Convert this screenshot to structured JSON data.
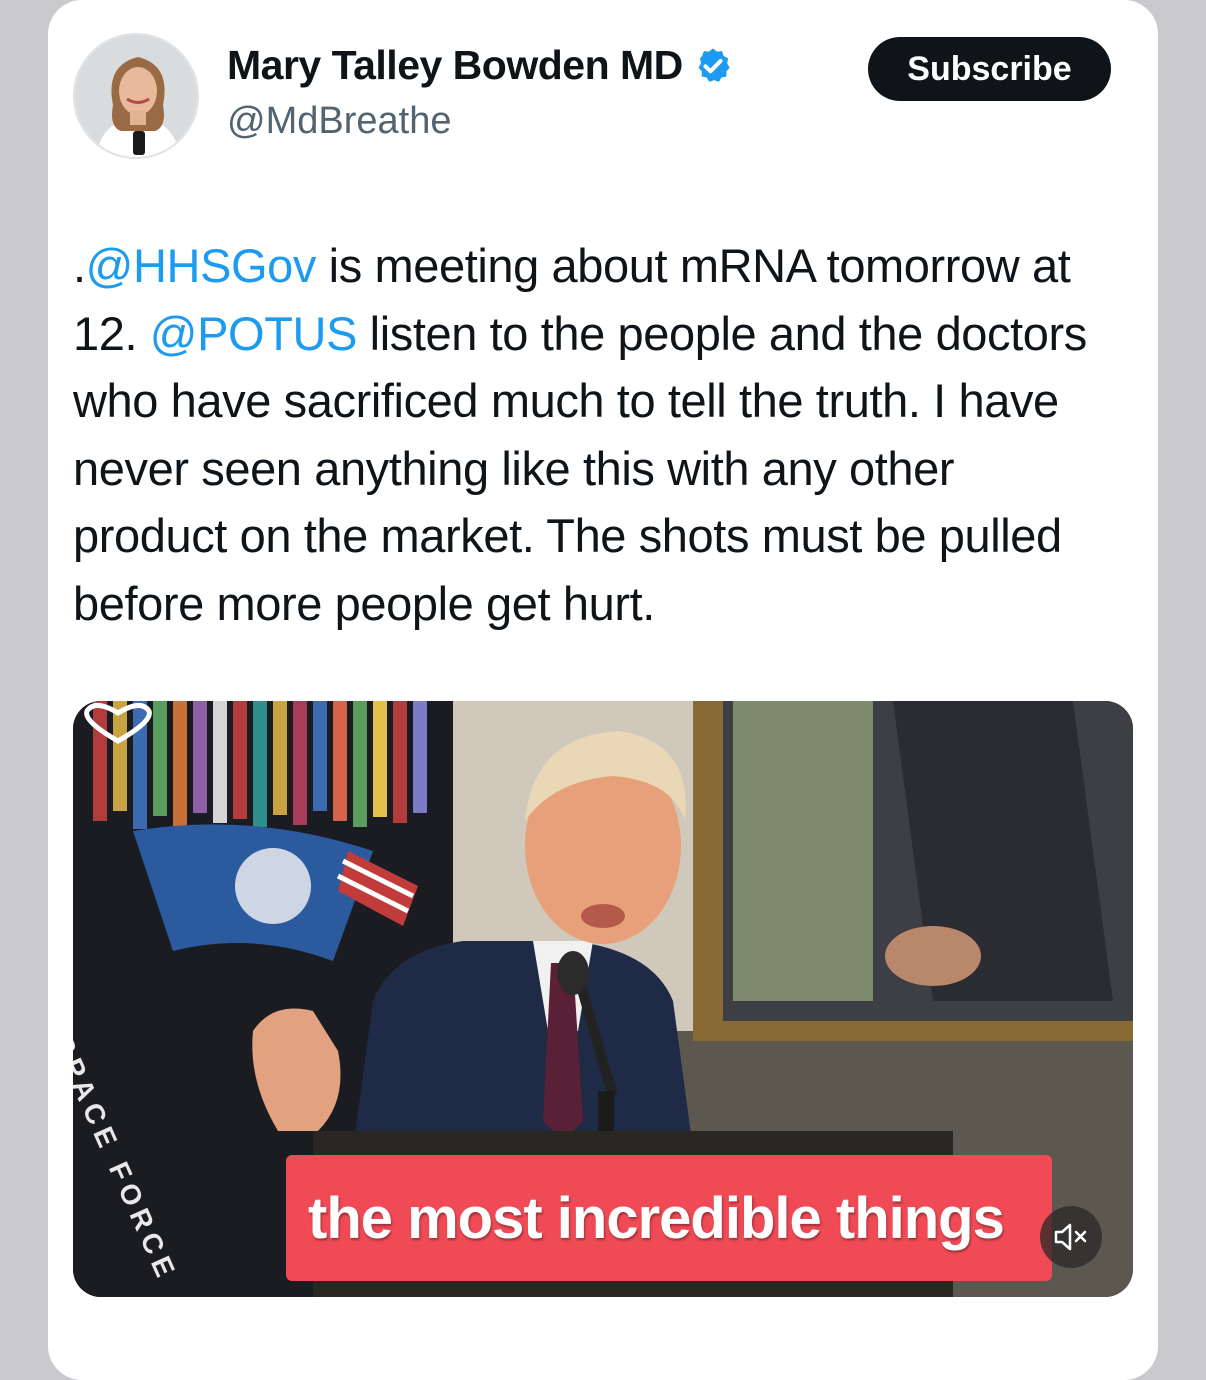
{
  "author": {
    "name": "Mary Talley Bowden MD",
    "handle": "@MdBreathe",
    "verified": true,
    "verified_color": "#1d9bf0"
  },
  "subscribe_label": "Subscribe",
  "tweet": {
    "lead": ".",
    "mention1": "@HHSGov",
    "text1": " is meeting about mRNA tomorrow at 12. ",
    "mention2": "@POTUS",
    "text2": " listen to the people and the doctors who have sacrificed much to tell the truth. I have never seen anything like this with any other product on the market. The shots must be pulled before more people get hurt.",
    "mention_color": "#1d9bf0"
  },
  "media": {
    "caption": "the most incredible things",
    "flag_text": "SPACE FORCE",
    "mute_icon": "speaker-muted-icon",
    "caption_bg": "#ef4a55"
  }
}
